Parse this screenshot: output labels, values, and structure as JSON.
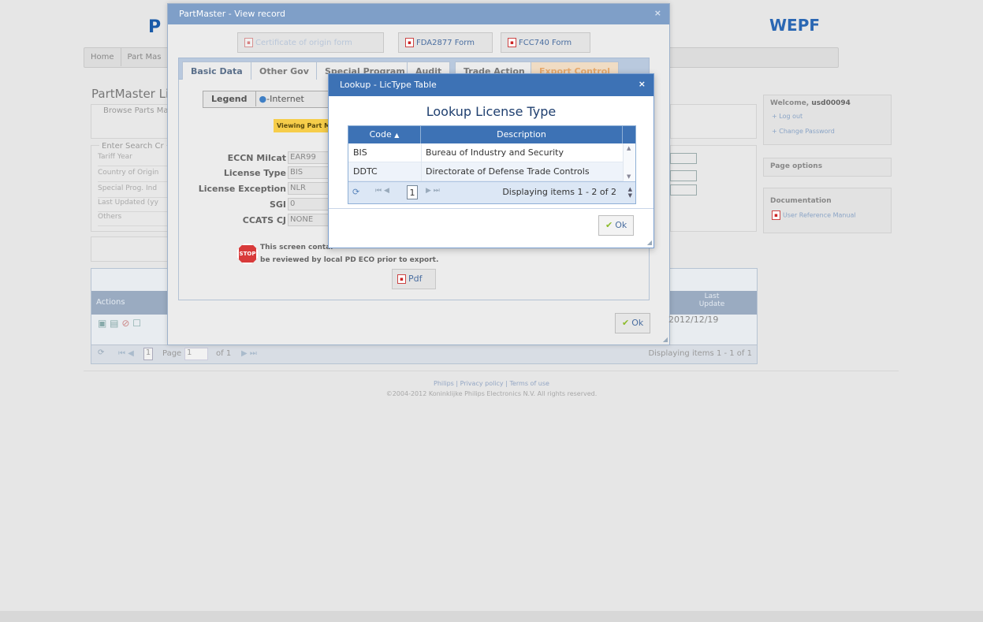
{
  "background": {
    "brand_letter": "P",
    "brand_right": "WEPF",
    "nav": [
      "Home",
      "Part Mas"
    ],
    "page_title": "PartMaster Li",
    "browse_legend": "Browse Parts Ma",
    "search_legend": "Enter Search Cr",
    "search_fields": [
      "Tariff Year",
      "Country of Origin",
      "Special Prog. Ind",
      "Last Updated (yy",
      "Others"
    ],
    "grid": {
      "actions_header": "Actions",
      "last_update_header": "Last\nUpdate",
      "row_date": "2012/12/19",
      "pager_page_label": "Page",
      "pager_page_value": "1",
      "pager_of": "of 1",
      "pager_box": "1",
      "pager_display": "Displaying items 1 - 1 of 1"
    },
    "sidebar": {
      "welcome_prefix": "Welcome, ",
      "welcome_user": "usd00094",
      "logout": "+ Log out",
      "change_password": "+ Change Password",
      "page_options": "Page options",
      "documentation": "Documentation",
      "manual": "User Reference Manual"
    },
    "footer": {
      "links": "Philips | Privacy policy | Terms of use",
      "copyright": "©2004-2012 Koninklijke Philips Electronics N.V. All rights reserved."
    }
  },
  "view_dialog": {
    "title": "PartMaster - View record",
    "close": "×",
    "buttons": {
      "certificate": "Certificate of origin form",
      "fda": "FDA2877 Form",
      "fcc": "FCC740 Form"
    },
    "tabs": [
      "Basic Data",
      "Other Gov",
      "Special Program",
      "Audit",
      "Trade Action",
      "Export Control"
    ],
    "legend_label": "Legend",
    "legend_item": "-Internet",
    "viewing_label": "Viewing Part M",
    "fields": [
      {
        "label": "ECCN Milcat",
        "value": "EAR99"
      },
      {
        "label": "License Type",
        "value": "BIS"
      },
      {
        "label": "License Exception",
        "value": "NLR"
      },
      {
        "label": "SGI",
        "value": "0"
      },
      {
        "label": "CCATS CJ",
        "value": "NONE"
      }
    ],
    "stop_text": "STOP",
    "warning_line1": "This screen contai",
    "warning_line2": "be reviewed by local PD ECO prior to export.",
    "pdf_button": "Pdf",
    "ok_button": "Ok"
  },
  "lookup_dialog": {
    "title": "Lookup - LicType Table",
    "close": "×",
    "heading": "Lookup License Type",
    "columns": {
      "code": "Code",
      "description": "Description"
    },
    "rows": [
      {
        "code": "BIS",
        "description": "Bureau of Industry and Security"
      },
      {
        "code": "DDTC",
        "description": "Directorate of Defense Trade Controls"
      }
    ],
    "pager": {
      "page": "1",
      "display": "Displaying items 1 - 2 of 2"
    },
    "ok_button": "Ok"
  }
}
